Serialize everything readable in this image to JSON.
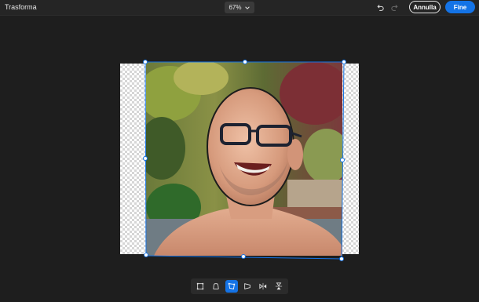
{
  "header": {
    "title": "Trasforma",
    "zoom": "67%",
    "undo_icon": "undo-icon",
    "redo_icon": "redo-icon",
    "cancel_label": "Annulla",
    "done_label": "Fine"
  },
  "canvas": {
    "image": "portrait-photo"
  },
  "toolbar": {
    "tools": [
      {
        "icon": "transform-icon",
        "active": false
      },
      {
        "icon": "warp-icon",
        "active": false
      },
      {
        "icon": "distort-icon",
        "active": true
      },
      {
        "icon": "perspective-icon",
        "active": false
      },
      {
        "icon": "flip-horizontal-icon",
        "active": false
      },
      {
        "icon": "flip-vertical-icon",
        "active": false
      }
    ]
  },
  "colors": {
    "accent": "#1473e6",
    "background": "#1e1e1e",
    "topbar": "#252525",
    "toolbar": "#2b2b2b"
  }
}
